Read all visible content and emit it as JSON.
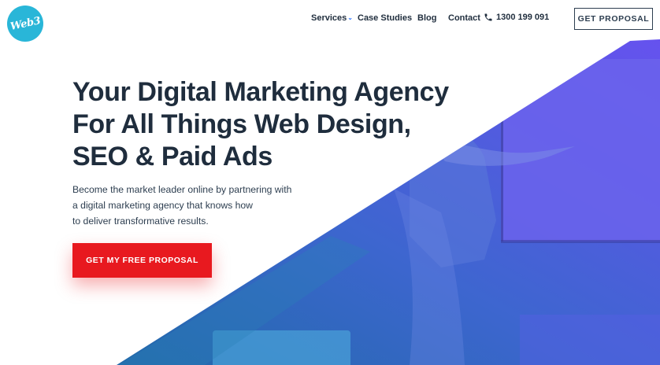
{
  "brand": {
    "logo_text": "Web3",
    "logo_color": "#29b6d8"
  },
  "nav": {
    "items": [
      {
        "label": "Services",
        "has_dropdown": true
      },
      {
        "label": "Case Studies",
        "has_dropdown": false
      },
      {
        "label": "Blog",
        "has_dropdown": false
      },
      {
        "label": "Contact",
        "has_dropdown": false
      }
    ],
    "dropdown_icon": "chevron-down-icon",
    "phone_icon": "phone-icon",
    "phone": "1300 199 091",
    "cta": "GET PROPOSAL"
  },
  "hero": {
    "headline_lines": [
      "Your Digital Marketing Agency",
      "For All Things Web Design,",
      "SEO & Paid Ads"
    ],
    "subtext_lines": [
      "Become the market leader online by partnering with",
      "a digital marketing agency that knows how",
      "to deliver transformative results."
    ],
    "cta": "GET MY FREE PROPOSAL",
    "cta_color": "#e8191f",
    "overlay_colors": [
      "#1e6fa6",
      "#4a5fe0",
      "#6a50f0"
    ]
  }
}
